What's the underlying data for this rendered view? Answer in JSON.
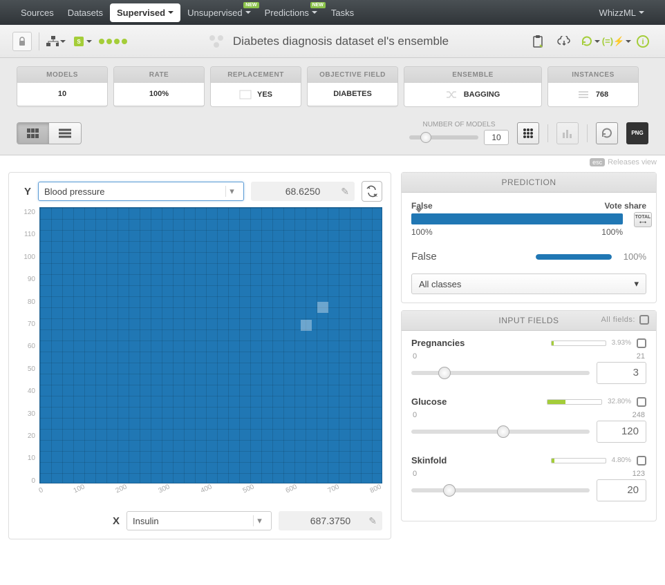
{
  "nav": {
    "sources": "Sources",
    "datasets": "Datasets",
    "supervised": "Supervised",
    "unsupervised": "Unsupervised",
    "predictions": "Predictions",
    "tasks": "Tasks",
    "whizzml": "WhizzML",
    "new_badge": "NEW"
  },
  "title": "Diabetes diagnosis dataset el's ensemble",
  "cards": {
    "models": {
      "label": "MODELS",
      "value": "10"
    },
    "rate": {
      "label": "RATE",
      "value": "100%"
    },
    "replacement": {
      "label": "REPLACEMENT",
      "value": "YES"
    },
    "objective": {
      "label": "OBJECTIVE FIELD",
      "value": "DIABETES"
    },
    "ensemble": {
      "label": "ENSEMBLE",
      "value": "BAGGING"
    },
    "instances": {
      "label": "INSTANCES",
      "value": "768"
    }
  },
  "num_models": {
    "label": "NUMBER OF MODELS",
    "value": "10"
  },
  "esc": {
    "key": "esc",
    "text": "Releases view"
  },
  "y_axis": {
    "label": "Y",
    "field": "Blood pressure",
    "value": "68.6250"
  },
  "x_axis": {
    "label": "X",
    "field": "Insulin",
    "value": "687.3750"
  },
  "chart_data": {
    "type": "heatmap",
    "x_field": "Insulin",
    "y_field": "Blood pressure",
    "x_ticks": [
      "0",
      "100",
      "200",
      "300",
      "400",
      "500",
      "600",
      "700",
      "800"
    ],
    "y_ticks": [
      "120",
      "110",
      "100",
      "90",
      "80",
      "70",
      "60",
      "50",
      "40",
      "30",
      "20",
      "10",
      "0"
    ],
    "xlim": [
      0,
      846
    ],
    "ylim": [
      0,
      122
    ],
    "highlight_cells": [
      {
        "x": 700,
        "y": 78
      },
      {
        "x": 660,
        "y": 70
      }
    ]
  },
  "prediction": {
    "title": "PREDICTION",
    "left_label": "False",
    "right_label": "Vote share",
    "left_pct": "100%",
    "right_pct": "100%",
    "total_label": "TOTAL",
    "classes": [
      {
        "name": "False",
        "pct": "100%",
        "fill": 100
      }
    ],
    "dropdown": "All classes"
  },
  "input_fields": {
    "title": "INPUT FIELDS",
    "all_fields": "All fields:",
    "fields": [
      {
        "name": "Pregnancies",
        "importance": "3.93%",
        "imp_fill": 4,
        "min": "0",
        "max": "21",
        "value": "3",
        "knob": 15
      },
      {
        "name": "Glucose",
        "importance": "32.80%",
        "imp_fill": 33,
        "min": "0",
        "max": "248",
        "value": "120",
        "knob": 48
      },
      {
        "name": "Skinfold",
        "importance": "4.80%",
        "imp_fill": 5,
        "min": "0",
        "max": "123",
        "value": "20",
        "knob": 18
      }
    ]
  }
}
